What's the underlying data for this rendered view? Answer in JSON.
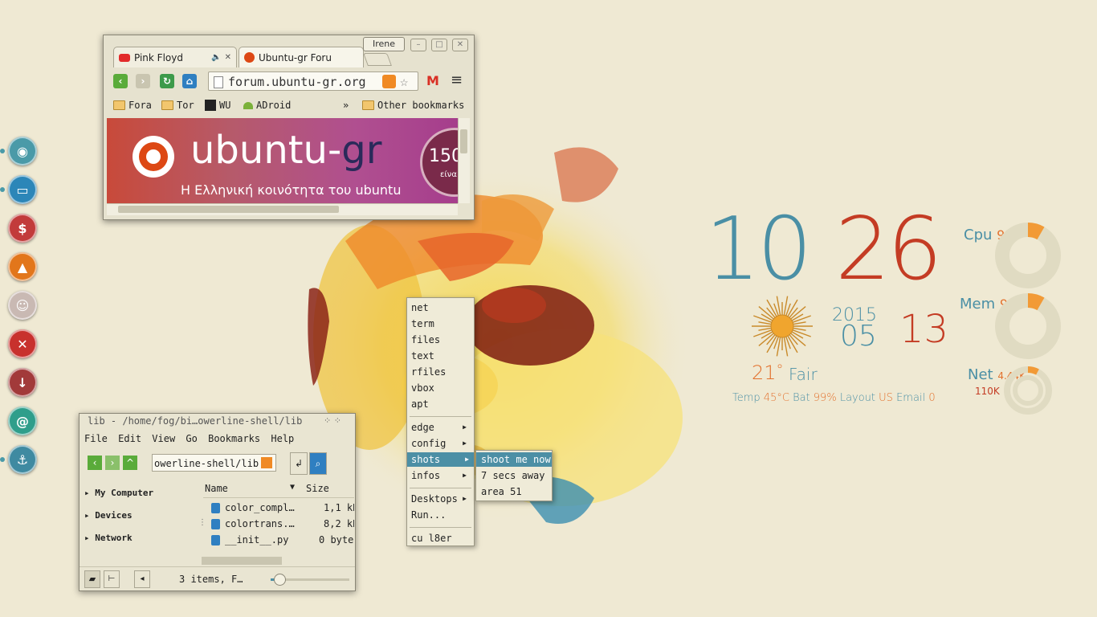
{
  "colors": {
    "accent_blue": "#4a8fa5",
    "accent_orange": "#e3702c",
    "accent_red": "#c43c24"
  },
  "dock": {
    "items": [
      {
        "name": "chromium",
        "glyph": "◉",
        "color": "#4a9aa8"
      },
      {
        "name": "file-manager",
        "glyph": "▭",
        "color": "#2c86b8"
      },
      {
        "name": "finance",
        "glyph": "$",
        "color": "#c23b3b"
      },
      {
        "name": "vlc",
        "glyph": "▲",
        "color": "#e2761b"
      },
      {
        "name": "cat-app",
        "glyph": "☺",
        "color": "#c9b9b3"
      },
      {
        "name": "close-app",
        "glyph": "✕",
        "color": "#c8312d"
      },
      {
        "name": "downloader",
        "glyph": "↓",
        "color": "#a23a3a"
      },
      {
        "name": "mail",
        "glyph": "@",
        "color": "#2f9e8b"
      },
      {
        "name": "anchor",
        "glyph": "⚓",
        "color": "#3f8aa1"
      }
    ]
  },
  "browser": {
    "profile": "Irene",
    "tabs": [
      {
        "title": "Pink Floyd",
        "icon": "youtube-icon",
        "audio": "🔈",
        "close": "✕"
      },
      {
        "title": "Ubuntu-gr Foru",
        "icon": "ubuntu-icon",
        "close": "✕"
      }
    ],
    "url": "forum.ubuntu-gr.org",
    "bookmarks": [
      "Fora",
      "Tor",
      "WU",
      "ADroid"
    ],
    "bookmarks_more": "»",
    "other_bookmarks": "Other bookmarks",
    "page": {
      "brand_a": "ubuntu-",
      "brand_b": "gr",
      "tagline": "Η Ελληνική κοινότητα του ubuntu",
      "counter": "150",
      "counter_sub": "είνα"
    }
  },
  "file_manager": {
    "title": "lib - /home/fog/bi…owerline-shell/lib",
    "menu": [
      "File",
      "Edit",
      "View",
      "Go",
      "Bookmarks",
      "Help"
    ],
    "path": "owerline-shell/lib",
    "sidebar": [
      "My Computer",
      "Devices",
      "Network"
    ],
    "columns": {
      "name": "Name",
      "size": "Size"
    },
    "files": [
      {
        "name": "color_compl…",
        "size": "1,1 kB"
      },
      {
        "name": "colortrans.…",
        "size": "8,2 kB"
      },
      {
        "name": "__init__.py",
        "size": "0 bytes"
      }
    ],
    "status": "3 items, F…",
    "zoom": 0.1
  },
  "menu": {
    "items_a": [
      "net",
      "term",
      "files",
      "text",
      "rfiles",
      "vbox",
      "apt"
    ],
    "items_b": [
      "edge",
      "config",
      "shots",
      "infos"
    ],
    "items_c": [
      "Desktops",
      "Run..."
    ],
    "items_d": [
      "cu l8er"
    ],
    "selected": "shots",
    "submenu": [
      "shoot me now",
      "7 secs away",
      "area 51"
    ]
  },
  "conky": {
    "hour": "10",
    "minute": "26",
    "year": "2015",
    "month": "05",
    "day": "13",
    "temperature": "21",
    "degree": "°",
    "condition": "Fair",
    "cpu": {
      "label": "Cpu",
      "value": "9%"
    },
    "mem": {
      "label": "Mem",
      "value": "9%"
    },
    "net": {
      "label": "Net",
      "up": "4.44K",
      "down": "110K"
    },
    "footer": {
      "temp_label": "Temp",
      "temp_value": "45°C",
      "bat_label": "Bat",
      "bat_value": "99%",
      "layout_label": "Layout",
      "layout_value": "US",
      "email_label": "Email",
      "email_value": "0"
    }
  }
}
